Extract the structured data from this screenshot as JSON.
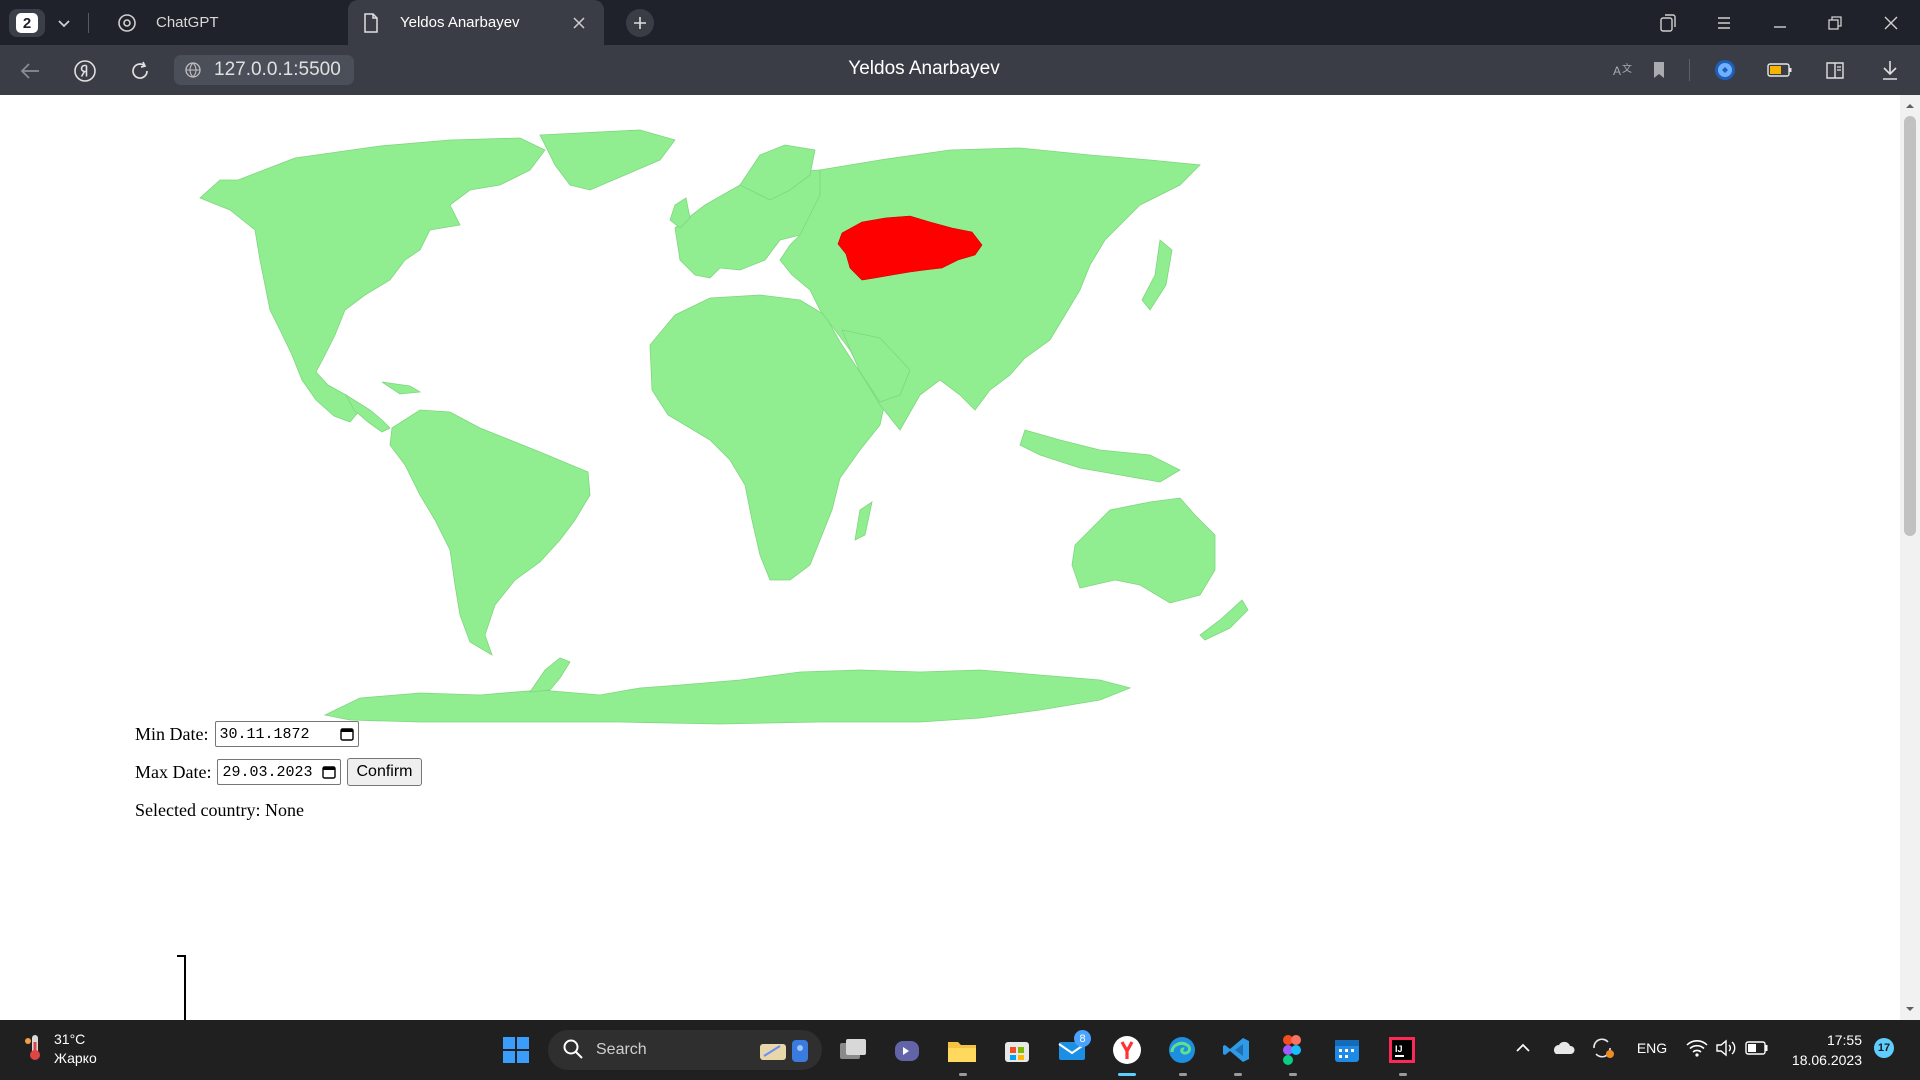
{
  "browser": {
    "tab_count": "2",
    "tabs": [
      {
        "label": "ChatGPT",
        "active": false
      },
      {
        "label": "Yeldos Anarbayev",
        "active": true
      }
    ],
    "url": "127.0.0.1:5500",
    "page_title": "Yeldos Anarbayev"
  },
  "map": {
    "land_color": "#90ee90",
    "highlight_color": "#ff0000",
    "highlighted_country": "Kazakhstan"
  },
  "form": {
    "min_label": "Min Date:",
    "min_value": "30.11.1872",
    "max_label": "Max Date:",
    "max_value": "29.03.2023",
    "confirm_label": "Confirm",
    "selected_text": "Selected country: None"
  },
  "taskbar": {
    "weather_temp": "31°C",
    "weather_desc": "Жарко",
    "search_placeholder": "Search",
    "mail_badge": "8",
    "language": "ENG",
    "time": "17:55",
    "date": "18.06.2023",
    "notifications": "17"
  }
}
